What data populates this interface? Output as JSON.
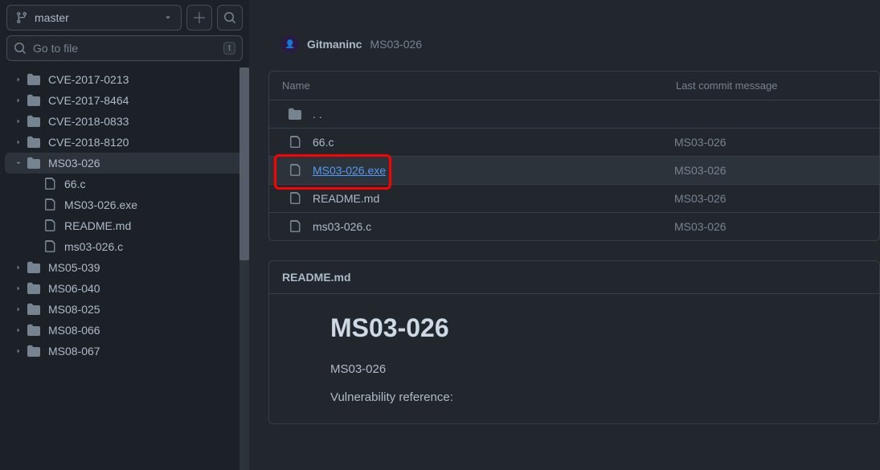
{
  "sidebar": {
    "branch_name": "master",
    "search_placeholder": "Go to file",
    "keyboard_hint": "t",
    "tree": [
      {
        "type": "folder",
        "name": "CVE-2017-0213",
        "expanded": false
      },
      {
        "type": "folder",
        "name": "CVE-2017-8464",
        "expanded": false
      },
      {
        "type": "folder",
        "name": "CVE-2018-0833",
        "expanded": false
      },
      {
        "type": "folder",
        "name": "CVE-2018-8120",
        "expanded": false
      },
      {
        "type": "folder",
        "name": "MS03-026",
        "expanded": true,
        "selected": true,
        "children": [
          {
            "type": "file",
            "name": "66.c"
          },
          {
            "type": "file",
            "name": "MS03-026.exe"
          },
          {
            "type": "file",
            "name": "README.md"
          },
          {
            "type": "file",
            "name": "ms03-026.c"
          }
        ]
      },
      {
        "type": "folder",
        "name": "MS05-039",
        "expanded": false
      },
      {
        "type": "folder",
        "name": "MS06-040",
        "expanded": false
      },
      {
        "type": "folder",
        "name": "MS08-025",
        "expanded": false
      },
      {
        "type": "folder",
        "name": "MS08-066",
        "expanded": false
      },
      {
        "type": "folder",
        "name": "MS08-067",
        "expanded": false
      }
    ]
  },
  "commit": {
    "author": "Gitmaninc",
    "title": "MS03-026"
  },
  "file_table": {
    "header_name": "Name",
    "header_commit": "Last commit message",
    "parent_link": ". .",
    "rows": [
      {
        "name": "66.c",
        "commit": "MS03-026",
        "highlighted": false,
        "icon": "file"
      },
      {
        "name": "MS03-026.exe",
        "commit": "MS03-026",
        "highlighted": true,
        "link": true,
        "icon": "file"
      },
      {
        "name": "README.md",
        "commit": "MS03-026",
        "highlighted": false,
        "icon": "file"
      },
      {
        "name": "ms03-026.c",
        "commit": "MS03-026",
        "highlighted": false,
        "icon": "file"
      }
    ]
  },
  "readme": {
    "filename": "README.md",
    "heading": "MS03-026",
    "line1": "MS03-026",
    "line2": "Vulnerability reference:"
  }
}
